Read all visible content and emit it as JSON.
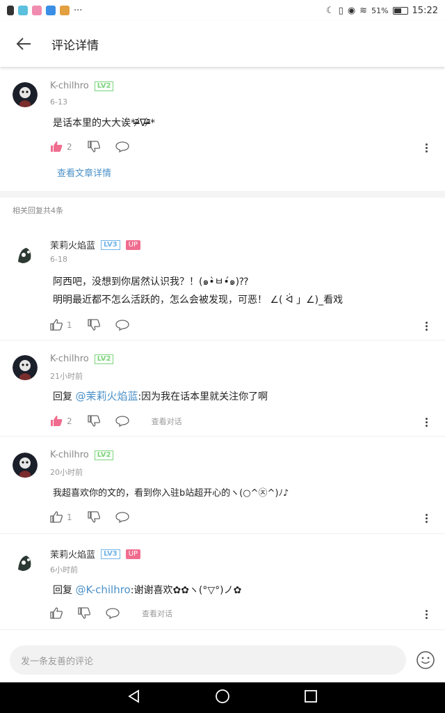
{
  "status_bar": {
    "battery": "51%",
    "time": "15:22",
    "more": "···"
  },
  "header": {
    "title": "评论详情"
  },
  "main_comment": {
    "username": "K-chilhro",
    "level": "LV2",
    "date": "6-13",
    "text": "是话本里的大大诶*ᵒ̴̶̷᷄ᐁᵒ̴̶̷᷅*",
    "likes": "2",
    "view_article": "查看文章详情"
  },
  "replies_count_label": "相关回复共4条",
  "replies": [
    {
      "username": "茉莉火焰蓝",
      "level": "LV3",
      "badge": "UP",
      "date": "6-18",
      "text_line1": "阿西吧，没想到你居然认识我？！(๑•̀ㅂ•́๑)⁇",
      "text_line2": "明明最近都不怎么活跃的，怎么会被发现，可恶！ ∠( ᐛ 」∠)_看戏",
      "likes": "1"
    },
    {
      "username": "K-chilhro",
      "level": "LV2",
      "date": "21小时前",
      "reply_prefix": "回复",
      "mention": "@茉莉火焰蓝",
      "text": ":因为我在话本里就关注你了啊",
      "likes": "2",
      "conversation": "查看对话"
    },
    {
      "username": "K-chilhro",
      "level": "LV2",
      "date": "20小时前",
      "text": "我超喜欢你的文的，看到你入驻b站超开心的ヽ(○^㉨^)ﾉ♪",
      "likes": "1"
    },
    {
      "username": "茉莉火焰蓝",
      "level": "LV3",
      "badge": "UP",
      "date": "6小时前",
      "reply_prefix": "回复",
      "mention": "@K-chilhro",
      "text": ":谢谢喜欢✿✿ヽ(°▽°)ノ✿",
      "conversation": "查看对话"
    }
  ],
  "comment_input": {
    "placeholder": "发一条友善的评论"
  },
  "colors": {
    "accent_blue": "#4a90c8",
    "like_pink": "#f06c8f",
    "lv2_green": "#7bd37b",
    "lv3_blue": "#6fb3e6"
  }
}
